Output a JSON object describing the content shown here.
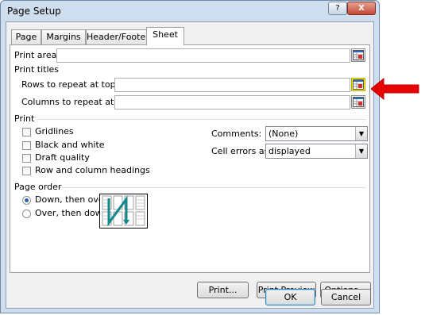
{
  "window": {
    "title": "Page Setup",
    "help_label": "?",
    "close_label": "X"
  },
  "tabs": [
    {
      "label": "Page"
    },
    {
      "label": "Margins"
    },
    {
      "label": "Header/Footer"
    },
    {
      "label": "Sheet",
      "active": true
    }
  ],
  "print_area": {
    "label": "Print area:",
    "value": ""
  },
  "print_titles": {
    "heading": "Print titles",
    "rows_label": "Rows to repeat at top:",
    "rows_value": "",
    "cols_label": "Columns to repeat at left:",
    "cols_value": ""
  },
  "print": {
    "heading": "Print",
    "options": [
      {
        "label": "Gridlines",
        "checked": false
      },
      {
        "label": "Black and white",
        "checked": false
      },
      {
        "label": "Draft quality",
        "checked": false
      },
      {
        "label": "Row and column headings",
        "checked": false
      }
    ],
    "comments_label": "Comments:",
    "comments_value": "(None)",
    "cell_errors_label": "Cell errors as:",
    "cell_errors_value": "displayed"
  },
  "page_order": {
    "heading": "Page order",
    "options": [
      {
        "label": "Down, then over",
        "selected": true
      },
      {
        "label": "Over, then down",
        "selected": false
      }
    ]
  },
  "buttons": {
    "print": "Print...",
    "print_preview": "Print Preview",
    "options": "Options...",
    "ok": "OK",
    "cancel": "Cancel"
  },
  "colors": {
    "highlight": "#ffff00",
    "arrow": "#e60000",
    "dialog_frame": "#cfdeee"
  },
  "icons": {
    "ref_button": "collapse-dialog-icon",
    "annotation": "red-arrow-icon"
  }
}
